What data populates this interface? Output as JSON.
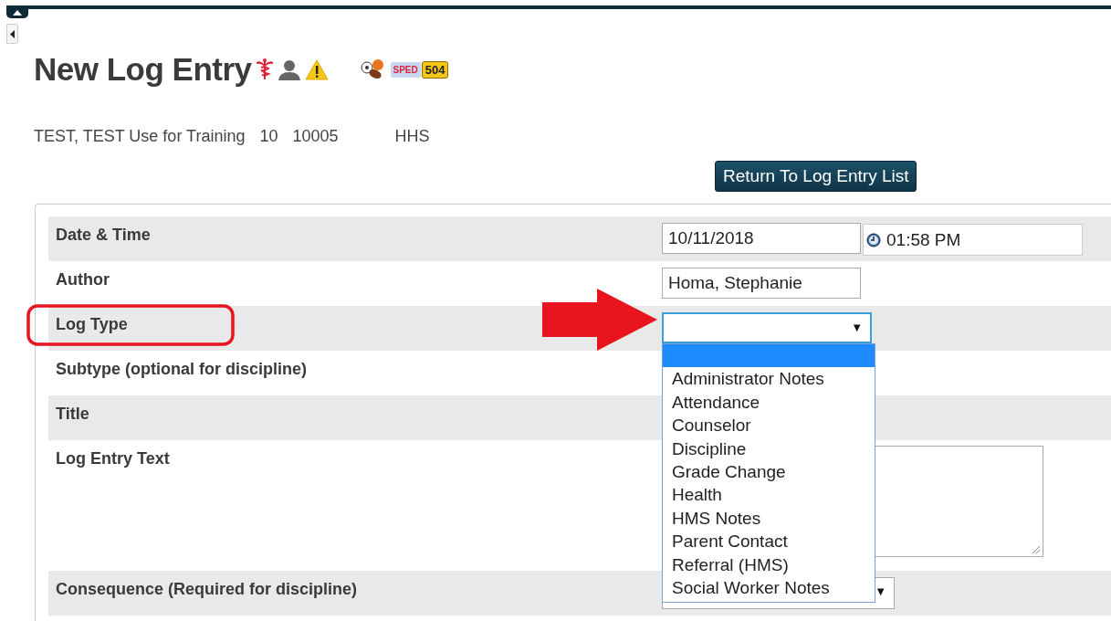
{
  "page_title": "New Log Entry",
  "badges": [
    {
      "kind": "sped",
      "label": "SPED"
    },
    {
      "kind": "plan",
      "label": "504"
    }
  ],
  "student": {
    "name": "TEST, TEST Use for Training",
    "grade": "10",
    "id": "10005",
    "school": "HHS"
  },
  "return_button": "Return To Log Entry List",
  "form": {
    "date": {
      "label": "Date & Time",
      "date": "10/11/2018",
      "time": "01:58 PM"
    },
    "author": {
      "label": "Author",
      "value": "Homa, Stephanie"
    },
    "log_type": {
      "label": "Log Type",
      "arrow": "▼",
      "expanded": true,
      "highlighted": true,
      "options": [
        {
          "selected": true
        },
        {
          "label": "Administrator Notes",
          "selected": false
        },
        {
          "label": "Attendance",
          "selected": false
        },
        {
          "label": "Counselor",
          "selected": false
        },
        {
          "label": "Discipline",
          "selected": false
        },
        {
          "label": "Grade Change",
          "selected": false
        },
        {
          "label": "Health",
          "selected": false
        },
        {
          "label": "HMS Notes",
          "selected": false
        },
        {
          "label": "Parent Contact",
          "selected": false
        },
        {
          "label": "Referral (HMS)",
          "selected": false
        },
        {
          "label": "Social Worker Notes",
          "selected": false
        }
      ]
    },
    "subtype": {
      "label": "Subtype (optional for discipline)"
    },
    "title": {
      "label": "Title"
    },
    "text": {
      "label": "Log Entry Text"
    },
    "consequence": {
      "label": "Consequence (Required for discipline)",
      "arrow": "▼"
    }
  }
}
